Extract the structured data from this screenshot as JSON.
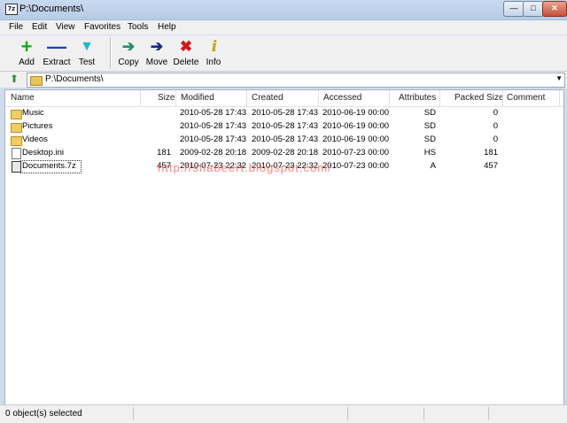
{
  "window": {
    "title": "P:\\Documents\\",
    "app_icon_text": "7z"
  },
  "menu": [
    "File",
    "Edit",
    "View",
    "Favorites",
    "Tools",
    "Help"
  ],
  "toolbar": {
    "add": "Add",
    "extract": "Extract",
    "test": "Test",
    "copy": "Copy",
    "move": "Move",
    "delete": "Delete",
    "info": "Info"
  },
  "address": {
    "path": "P:\\Documents\\"
  },
  "columns": [
    "Name",
    "Size",
    "Modified",
    "Created",
    "Accessed",
    "Attributes",
    "Packed Size",
    "Comment"
  ],
  "rows": [
    {
      "name": "Music",
      "size": "",
      "modified": "2010-05-28 17:43",
      "created": "2010-05-28 17:43",
      "accessed": "2010-06-19 00:00",
      "attributes": "SD",
      "packed": "0",
      "type": "folder"
    },
    {
      "name": "Pictures",
      "size": "",
      "modified": "2010-05-28 17:43",
      "created": "2010-05-28 17:43",
      "accessed": "2010-06-19 00:00",
      "attributes": "SD",
      "packed": "0",
      "type": "folder"
    },
    {
      "name": "Videos",
      "size": "",
      "modified": "2010-05-28 17:43",
      "created": "2010-05-28 17:43",
      "accessed": "2010-06-19 00:00",
      "attributes": "SD",
      "packed": "0",
      "type": "folder"
    },
    {
      "name": "Desktop.ini",
      "size": "181",
      "modified": "2009-02-28 20:18",
      "created": "2009-02-28 20:18",
      "accessed": "2010-07-23 00:00",
      "attributes": "HS",
      "packed": "181",
      "type": "file"
    },
    {
      "name": "Documents.7z",
      "size": "457",
      "modified": "2010-07-23 22:32",
      "created": "2010-07-23 22:32",
      "accessed": "2010-07-23 00:00",
      "attributes": "A",
      "packed": "457",
      "type": "archive"
    }
  ],
  "watermark": "http://shabeert.blogspot.com/",
  "status": {
    "selected": "0 object(s) selected"
  },
  "colors": {
    "add_icon": "#1aa81a",
    "extract_icon": "#1a3fb5",
    "test_icon": "#23b8c8",
    "copy_icon": "#2a8a6a",
    "move_icon": "#1a2a8a",
    "delete_icon": "#d11a1a",
    "info_icon": "#c8a400"
  },
  "icons": {
    "add": "plus-icon",
    "extract": "minus-icon",
    "test": "checkmark-icon",
    "copy": "arrow-right-icon",
    "move": "arrow-right-icon",
    "delete": "x-icon",
    "info": "info-icon",
    "up": "up-folder-icon"
  }
}
